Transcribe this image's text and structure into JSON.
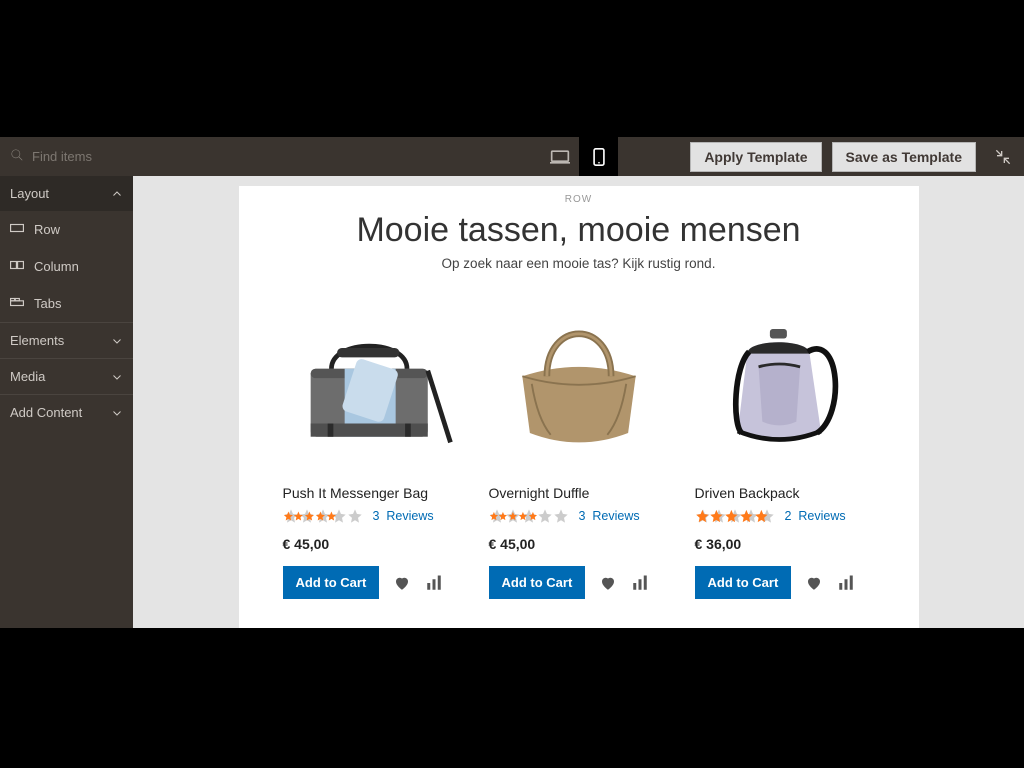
{
  "toolbar": {
    "search_placeholder": "Find items",
    "apply_template": "Apply Template",
    "save_template": "Save as Template"
  },
  "sidebar": {
    "groups": [
      {
        "label": "Layout",
        "expanded": true
      },
      {
        "label": "Elements",
        "expanded": false
      },
      {
        "label": "Media",
        "expanded": false
      },
      {
        "label": "Add Content",
        "expanded": false
      }
    ],
    "layout_items": [
      {
        "label": "Row"
      },
      {
        "label": "Column"
      },
      {
        "label": "Tabs"
      }
    ]
  },
  "page": {
    "row_label": "ROW",
    "headline": "Mooie tassen, mooie mensen",
    "subhead": "Op zoek naar een mooie tas? Kijk rustig rond."
  },
  "common": {
    "reviews_word": "Reviews",
    "add_to_cart": "Add to Cart"
  },
  "products": [
    {
      "name": "Push It Messenger Bag",
      "rating": 3.3,
      "review_count": 3,
      "price": "€ 45,00"
    },
    {
      "name": "Overnight Duffle",
      "rating": 3.0,
      "review_count": 3,
      "price": "€ 45,00"
    },
    {
      "name": "Driven Backpack",
      "rating": 4.5,
      "review_count": 2,
      "price": "€ 36,00"
    }
  ]
}
